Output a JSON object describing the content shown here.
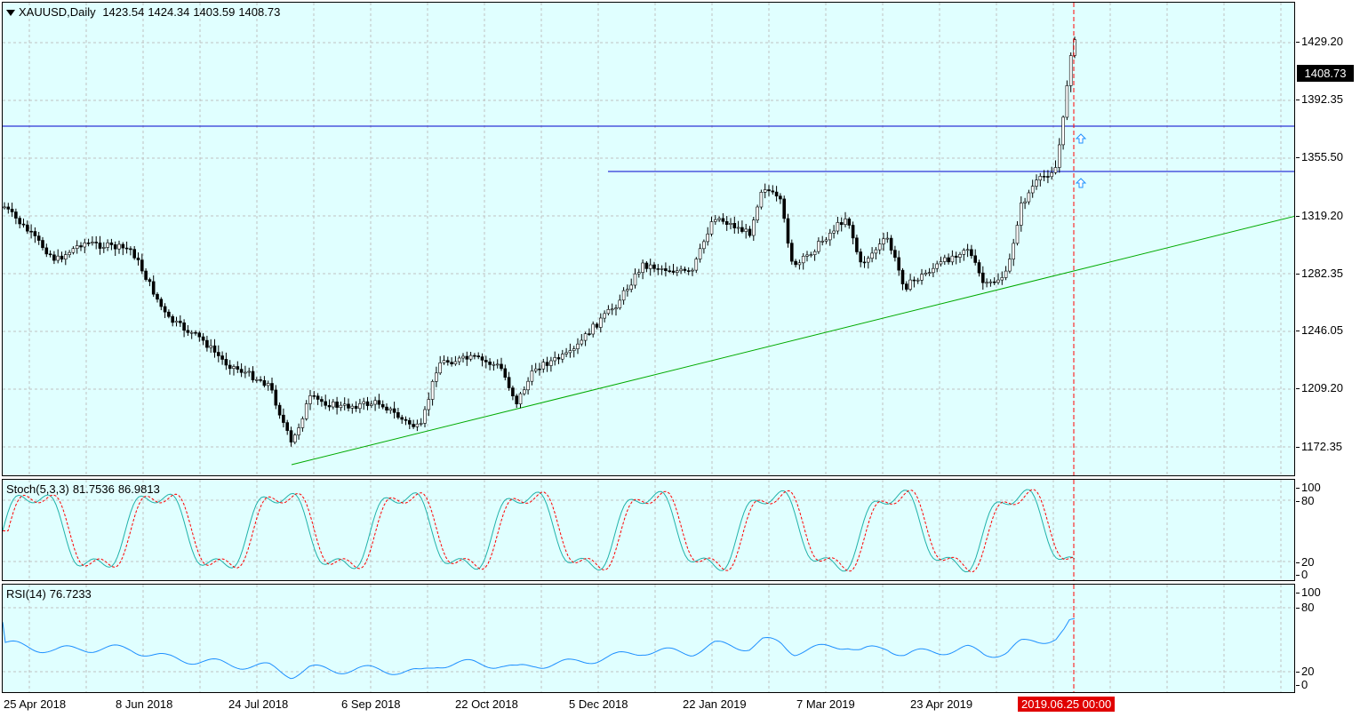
{
  "main": {
    "symbol": "XAUUSD,Daily",
    "ohlc": [
      "1423.54",
      "1424.34",
      "1403.59",
      "1408.73"
    ],
    "current_price": "1408.73",
    "y_ticks": [
      "1429.20",
      "1392.35",
      "1355.50",
      "1319.20",
      "1282.35",
      "1246.05",
      "1209.20",
      "1172.35"
    ],
    "colors": {
      "background": "#e0ffff",
      "candle": "#000000",
      "resistance_line": "#0000cc",
      "trend_line": "#00aa00",
      "cursor": "#ff0000",
      "arrow": "#1e90ff"
    },
    "arrow_icons": [
      "up-arrow-icon",
      "up-arrow-icon"
    ]
  },
  "stoch": {
    "name": "Stoch(5,3,3)",
    "main_value": "81.7536",
    "signal_value": "86.9813",
    "levels": [
      "100",
      "80",
      "20",
      "0"
    ],
    "colors": {
      "main": "#20b2aa",
      "signal": "#ff0000"
    }
  },
  "rsi": {
    "name": "RSI(14)",
    "value": "76.7233",
    "levels": [
      "100",
      "80",
      "20",
      "0"
    ],
    "colors": {
      "line": "#1e90ff"
    }
  },
  "xaxis": {
    "labels": [
      "25 Apr 2018",
      "8 Jun 2018",
      "24 Jul 2018",
      "6 Sep 2018",
      "22 Oct 2018",
      "5 Dec 2018",
      "22 Jan 2019",
      "7 Mar 2019",
      "23 Apr 2019"
    ],
    "cursor_label": "2019.06.25 00:00"
  }
}
